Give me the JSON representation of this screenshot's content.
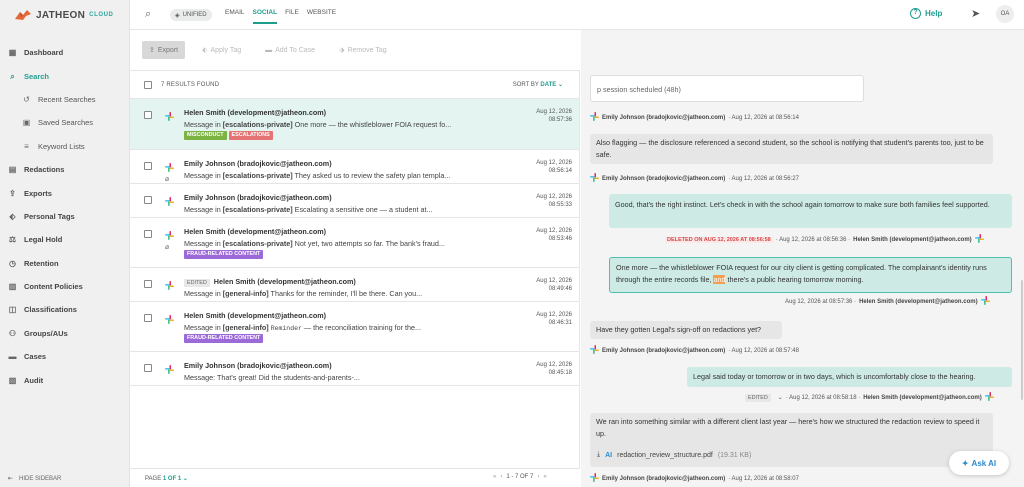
{
  "brand": {
    "name": "JATHEON",
    "suffix": "CLOUD"
  },
  "sidebar": {
    "items": [
      {
        "label": "Dashboard",
        "icon": "dashboard-icon"
      },
      {
        "label": "Search",
        "icon": "search-icon",
        "active": true
      },
      {
        "label": "Recent Searches",
        "icon": "history-icon",
        "sub": true
      },
      {
        "label": "Saved Searches",
        "icon": "save-icon",
        "sub": true
      },
      {
        "label": "Keyword Lists",
        "icon": "list-icon",
        "sub": true
      },
      {
        "label": "Redactions",
        "icon": "redaction-icon"
      },
      {
        "label": "Exports",
        "icon": "export-icon"
      },
      {
        "label": "Personal Tags",
        "icon": "tag-icon"
      },
      {
        "label": "Legal Hold",
        "icon": "gavel-icon"
      },
      {
        "label": "Retention",
        "icon": "retention-icon"
      },
      {
        "label": "Content Policies",
        "icon": "policy-icon"
      },
      {
        "label": "Classifications",
        "icon": "classification-icon"
      },
      {
        "label": "Groups/AUs",
        "icon": "groups-icon"
      },
      {
        "label": "Cases",
        "icon": "folder-icon"
      },
      {
        "label": "Audit",
        "icon": "audit-icon"
      }
    ],
    "hide_label": "HIDE SIDEBAR"
  },
  "topbar": {
    "unified": "UNIFIED",
    "tabs": [
      "EMAIL",
      "SOCIAL",
      "FILE",
      "WEBSITE"
    ],
    "active_tab": "SOCIAL",
    "help": "Help",
    "avatar": "OA"
  },
  "toolbar": {
    "export": "Export",
    "apply_tag": "Apply Tag",
    "add_to_case": "Add To Case",
    "remove_tag": "Remove Tag"
  },
  "results": {
    "count_label": "7 RESULTS FOUND",
    "sort_label": "SORT BY",
    "sort_value": "DATE",
    "rows": [
      {
        "title": "Helen Smith (development@jatheon.com)",
        "pre": "Message in ",
        "channel": "[escalations-private]",
        "text": " One more — the whistleblower FOIA request fo...",
        "date": "Aug 12, 2026",
        "time": "08:57:36",
        "tags": [
          {
            "label": "MISCONDUCT",
            "color": "#7cb342"
          },
          {
            "label": "ESCALATIONS",
            "color": "#e57373"
          }
        ],
        "clip": false,
        "edited": "",
        "selected": true
      },
      {
        "title": "Emily Johnson (bradojkovic@jatheon.com)",
        "pre": "Message in ",
        "channel": "[escalations-private]",
        "text": " They asked us to review the safety plan templa...",
        "date": "Aug 12, 2026",
        "time": "08:56:14",
        "tags": [],
        "clip": true,
        "edited": ""
      },
      {
        "title": "Emily Johnson (bradojkovic@jatheon.com)",
        "pre": "Message in ",
        "channel": "[escalations-private]",
        "text": " Escalating a sensitive one — a student at...",
        "date": "Aug 12, 2026",
        "time": "08:55:33",
        "tags": [],
        "clip": false,
        "edited": ""
      },
      {
        "title": "Helen Smith (development@jatheon.com)",
        "pre": "Message in ",
        "channel": "[escalations-private]",
        "text": " Not yet, two attempts so far. The bank's fraud...",
        "date": "Aug 12, 2026",
        "time": "08:53:46",
        "tags": [
          {
            "label": "FRAUD-RELATED CONTENT",
            "color": "#9c6ad8"
          }
        ],
        "clip": true,
        "edited": ""
      },
      {
        "title": "Helen Smith (development@jatheon.com)",
        "pre": "Message in ",
        "channel": "[general-info]",
        "text": " Thanks for the reminder, I'll be there. Can you...",
        "date": "Aug 12, 2026",
        "time": "08:49:46",
        "tags": [],
        "clip": false,
        "edited": "EDITED"
      },
      {
        "title": "Helen Smith (development@jatheon.com)",
        "pre": "Message in ",
        "channel": "[general-info]",
        "mono": "Reminder",
        "text": " — the reconciliation training for the...",
        "date": "Aug 12, 2026",
        "time": "08:46:31",
        "tags": [
          {
            "label": "FRAUD-RELATED CONTENT",
            "color": "#9c6ad8"
          }
        ],
        "clip": false,
        "edited": ""
      },
      {
        "title": "Emily Johnson (bradojkovic@jatheon.com)",
        "pre": "Message: That's great! Did the students-and-parents-...",
        "channel": "",
        "text": "",
        "date": "Aug 12, 2026",
        "time": "08:45:18",
        "tags": [],
        "clip": false,
        "edited": ""
      }
    ]
  },
  "pager": {
    "page_label": "PAGE",
    "page_value": "1 OF 1",
    "range": "1 - 7 OF 7"
  },
  "chat": {
    "top_snippet": "p session scheduled (48h)",
    "m1_meta": {
      "author": "Emily Johnson (bradojkovic@jatheon.com)",
      "time": "· Aug 12, 2026 at 08:56:14"
    },
    "m2": "Also flagging — the disclosure referenced a second student, so the school is notifying that student's parents too, just to be safe.",
    "m2_meta": {
      "author": "Emily Johnson (bradojkovic@jatheon.com)",
      "time": "· Aug 12, 2026 at 08:56:27"
    },
    "m3": "Good, that's the right instinct. Let's check in with the school again tomorrow to make sure both families feel supported.",
    "m3_meta": {
      "deleted": "DELETED ON AUG 12, 2026 AT 08:56:58",
      "time": "· Aug 12, 2026 at 08:56:36 ·",
      "author": "Helen Smith (development@jatheon.com)"
    },
    "m4_pre": "One more — the whistleblower FOIA request for our city client is getting complicated. The complainant's identity runs through the entire records file, ",
    "m4_hl": "and",
    "m4_post": " there's a public hearing tomorrow morning.",
    "m4_meta": {
      "time": "Aug 12, 2026 at 08:57:36 ·",
      "author": "Helen Smith (development@jatheon.com)"
    },
    "m5": "Have they gotten Legal's sign-off on redactions yet?",
    "m5_meta": {
      "author": "Emily Johnson (bradojkovic@jatheon.com)",
      "time": "· Aug 12, 2026 at 08:57:48"
    },
    "m6": "Legal said today or tomorrow or in two days, which is uncomfortably close to the hearing.",
    "m6_meta": {
      "edited": "EDITED",
      "time": "· Aug 12, 2026 at 08:58:18 ·",
      "author": "Helen Smith (development@jatheon.com)"
    },
    "m7": "We ran into something similar with a different client last year — here's how we structured the redaction review to speed it up.",
    "m7_att": {
      "name": "redaction_review_structure.pdf",
      "size": "(19.31 KB)",
      "ai": "AI"
    },
    "m7_meta": {
      "author": "Emily Johnson (bradojkovic@jatheon.com)",
      "time": "· Aug 12, 2026 at 08:58:07"
    }
  },
  "ask_ai": "Ask AI",
  "colors": {
    "accent": "#1f9e8e",
    "selected_row": "#e3f4f1",
    "right_bubble": "#cdebe4"
  }
}
